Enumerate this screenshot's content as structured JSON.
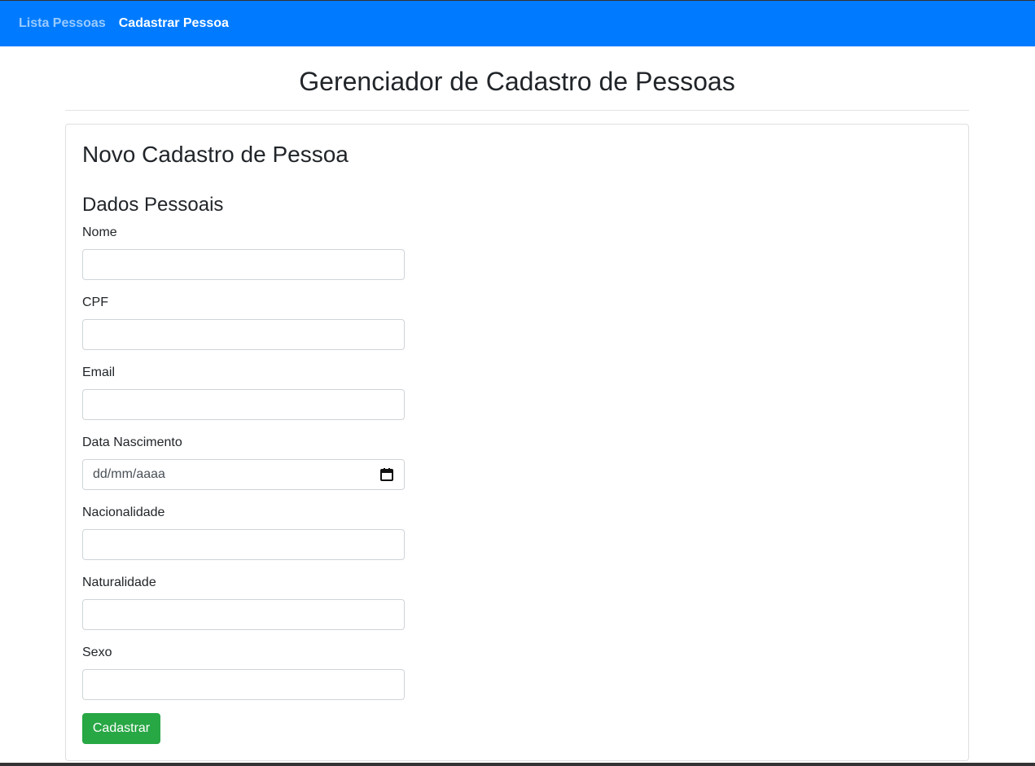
{
  "nav": {
    "items": [
      {
        "label": "Lista Pessoas",
        "active": false
      },
      {
        "label": "Cadastrar Pessoa",
        "active": true
      }
    ],
    "background": "#007bff"
  },
  "page": {
    "title": "Gerenciador de Cadastro de Pessoas"
  },
  "form": {
    "card_title": "Novo Cadastro de Pessoa",
    "section_title": "Dados Pessoais",
    "fields": [
      {
        "label": "Nome",
        "value": ""
      },
      {
        "label": "CPF",
        "value": ""
      },
      {
        "label": "Email",
        "value": ""
      },
      {
        "label": "Data Nascimento",
        "placeholder": "dd/mm/aaaa",
        "type": "date",
        "icon": "calendar-icon"
      },
      {
        "label": "Nacionalidade",
        "value": ""
      },
      {
        "label": "Naturalidade",
        "value": ""
      },
      {
        "label": "Sexo",
        "value": ""
      }
    ],
    "submit_label": "Cadastrar",
    "submit_color": "#28a745"
  }
}
